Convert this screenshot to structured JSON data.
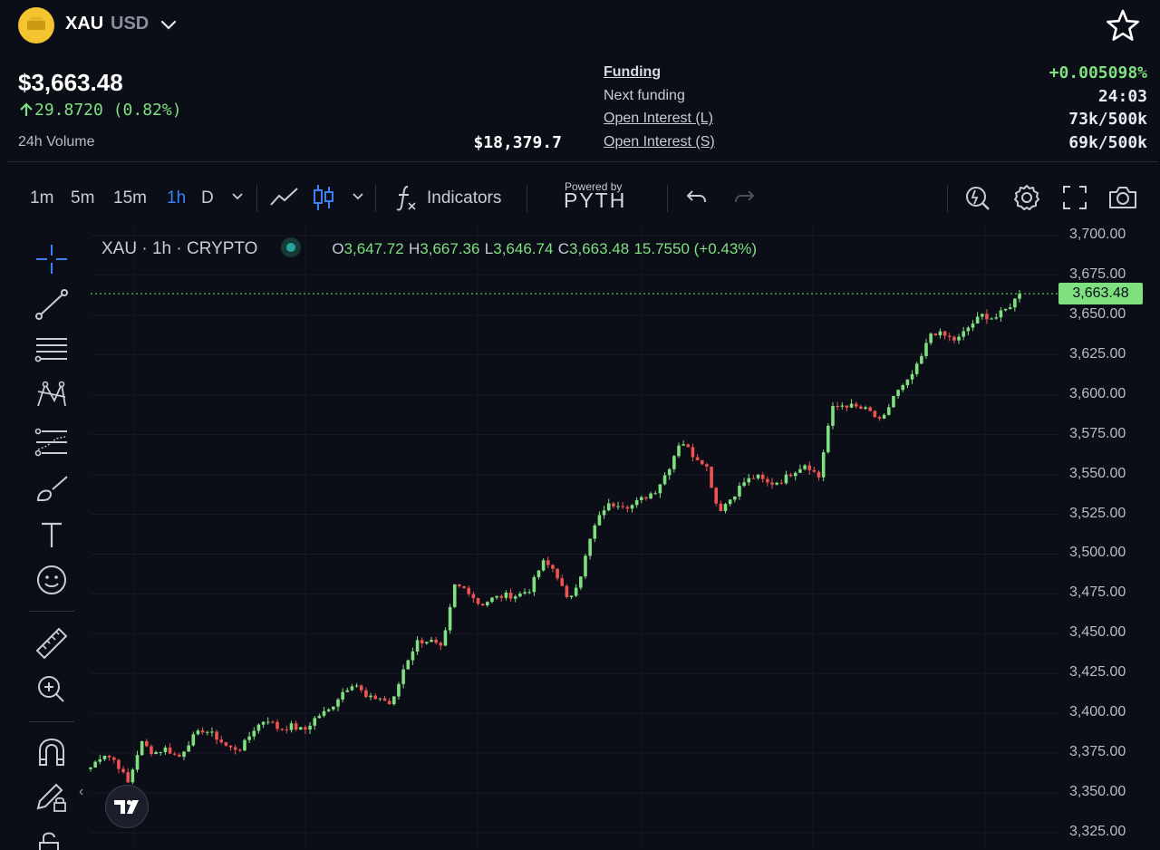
{
  "header": {
    "base": "XAU",
    "quote": "USD",
    "icons": {
      "asset": "gold-bars-icon",
      "dropdown": "chevron-down-icon",
      "favorite": "star-icon"
    }
  },
  "stats": {
    "price": "$3,663.48",
    "change": "29.8720 (0.82%)",
    "volume_label": "24h Volume",
    "volume_value": "$18,379.7",
    "funding_label": "Funding",
    "funding_value": "+0.005098%",
    "next_funding_label": "Next funding",
    "next_funding_value": "24:03",
    "oi_long_label": "Open Interest (L)",
    "oi_long_value": "73k/500k",
    "oi_short_label": "Open Interest (S)",
    "oi_short_value": "69k/500k"
  },
  "toolbar": {
    "timeframes": [
      "1m",
      "5m",
      "15m",
      "1h",
      "D"
    ],
    "active_timeframe": "1h",
    "indicators_label": "Indicators",
    "powered_by": "Powered by",
    "pyth": "PYTH"
  },
  "legend": {
    "title": "XAU · 1h · CRYPTO",
    "o_label": "O",
    "o": "3,647.72",
    "h_label": "H",
    "h": "3,667.36",
    "l_label": "L",
    "l": "3,646.74",
    "c_label": "C",
    "c": "3,663.48",
    "change": "15.7550 (+0.43%)"
  },
  "colors": {
    "up": "#7ee07e",
    "down": "#ef5350",
    "accent": "#3b82f6",
    "background": "#0b0d17"
  },
  "chart_data": {
    "type": "candlestick",
    "symbol": "XAU",
    "interval": "1h",
    "ylim": [
      3325,
      3700
    ],
    "y_ticks": [
      "3,700.00",
      "3,675.00",
      "3,650.00",
      "3,625.00",
      "3,600.00",
      "3,575.00",
      "3,550.00",
      "3,525.00",
      "3,500.00",
      "3,475.00",
      "3,450.00",
      "3,425.00",
      "3,400.00",
      "3,375.00",
      "3,350.00",
      "3,325.00"
    ],
    "last_price": 3663.48,
    "last_price_label": "3,663.48",
    "path_closes": [
      3366,
      3375,
      3370,
      3356,
      3382,
      3375,
      3378,
      3372,
      3384,
      3390,
      3385,
      3378,
      3378,
      3390,
      3397,
      3390,
      3392,
      3389,
      3398,
      3402,
      3413,
      3420,
      3409,
      3410,
      3405,
      3430,
      3445,
      3446,
      3440,
      3480,
      3478,
      3468,
      3472,
      3474,
      3474,
      3478,
      3495,
      3490,
      3470,
      3486,
      3515,
      3530,
      3532,
      3530,
      3535,
      3540,
      3553,
      3572,
      3562,
      3557,
      3527,
      3535,
      3545,
      3549,
      3544,
      3546,
      3552,
      3557,
      3548,
      3591,
      3594,
      3592,
      3590,
      3582,
      3600,
      3607,
      3620,
      3640,
      3637,
      3634,
      3643,
      3650,
      3648,
      3654,
      3663
    ]
  }
}
